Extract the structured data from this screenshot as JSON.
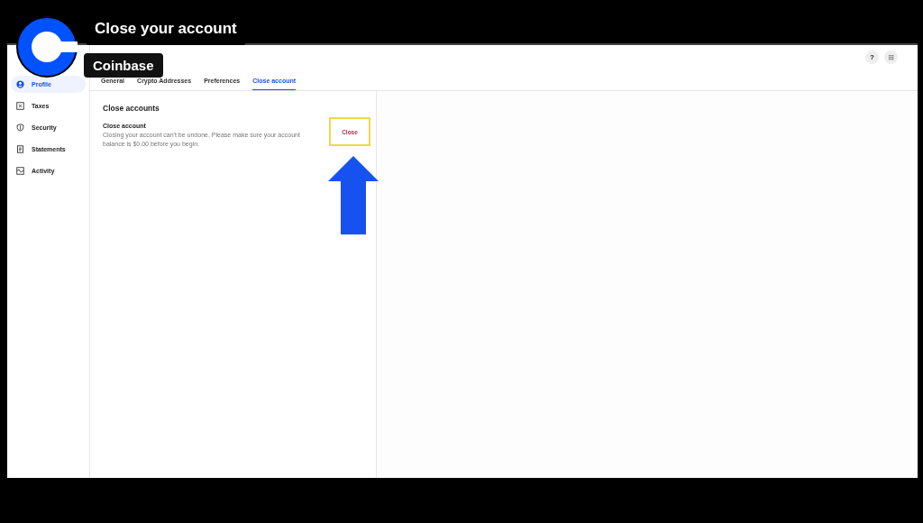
{
  "overlay": {
    "title": "Close your account",
    "tag": "Coinbase"
  },
  "sidebar": {
    "items": [
      {
        "label": "Profile",
        "selected": true
      },
      {
        "label": "Taxes",
        "selected": false
      },
      {
        "label": "Security",
        "selected": false
      },
      {
        "label": "Statements",
        "selected": false
      },
      {
        "label": "Activity",
        "selected": false
      }
    ]
  },
  "tabs": [
    {
      "label": "General",
      "selected": false
    },
    {
      "label": "Crypto Addresses",
      "selected": false
    },
    {
      "label": "Preferences",
      "selected": false
    },
    {
      "label": "Close account",
      "selected": true
    }
  ],
  "header_buttons": [
    "?"
  ],
  "section": {
    "title": "Close accounts",
    "item_title": "Close account",
    "description": "Closing your account can't be undone. Please make sure your account balance is $0.00 before you begin.",
    "button": "Close"
  }
}
